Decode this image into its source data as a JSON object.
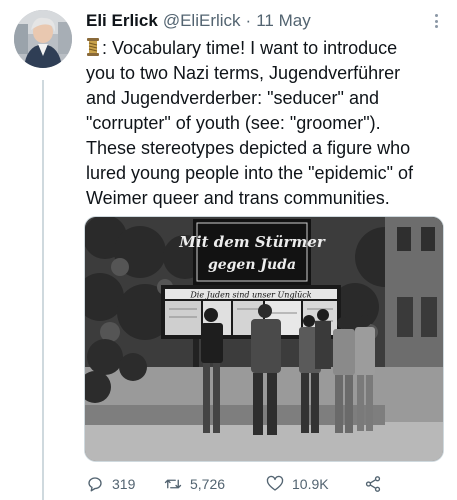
{
  "tweet": {
    "author_name": "Eli Erlick",
    "author_handle": "@EliErlick",
    "separator": "·",
    "date": "11 May",
    "text": ": Vocabulary time! I want to introduce\nyou to two Nazi terms, Jugendverführer\nand Jugendverderber: \"seducer\" and\n\"corrupter\" of youth (see: \"groomer\").\nThese stereotypes depicted a figure who\nlured young people into the \"epidemic\" of\nWeimer queer and trans communities.",
    "leading_emoji": "thread-spool-icon"
  },
  "photo": {
    "sign_line1": "Mit dem Stürmer",
    "sign_line2": "gegen Juda",
    "board_caption": "Die Juden sind unser Unglück"
  },
  "stats": {
    "replies": "319",
    "retweets": "5,726",
    "likes": "10.9K"
  },
  "colors": {
    "text": "#0f1419",
    "secondary": "#536471",
    "border": "#cfd9de"
  }
}
